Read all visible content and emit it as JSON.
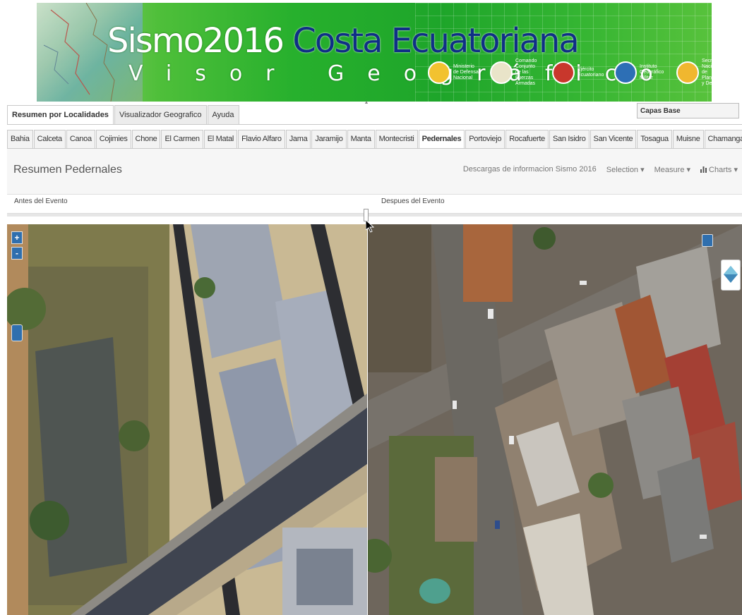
{
  "banner": {
    "title_part1": "Sismo2016",
    "title_part2": "Costa Ecuatoriana",
    "subtitle": "Visor Geográfico",
    "logos": [
      {
        "name": "Ministerio de Defensa Nacional",
        "lines": [
          "Ministerio",
          "de Defensa",
          "Nacional"
        ],
        "color": "#f2c230"
      },
      {
        "name": "Comando Conjunto de las Fuerzas Armadas",
        "lines": [
          "Comando Conjunto",
          "de las Fuerzas",
          "Armadas"
        ],
        "color": "#e9e4c9"
      },
      {
        "name": "Ejército Ecuatoriano",
        "lines": [
          "Ejército",
          "Ecuatoriano"
        ],
        "color": "#c8372c"
      },
      {
        "name": "Instituto Geográfico Militar",
        "lines": [
          "Instituto",
          "Geográfico",
          "Militar"
        ],
        "color": "#2d6fb5"
      },
      {
        "name": "Secretaría Nacional de Planificación y Desarrollo",
        "lines": [
          "Secretaría Nacional",
          "de Planificación",
          "y Desarrollo"
        ],
        "color": "#f0b72f"
      }
    ]
  },
  "main_tabs": [
    {
      "label": "Resumen por Localidades",
      "active": true
    },
    {
      "label": "Visualizador Geografico",
      "active": false
    },
    {
      "label": "Ayuda",
      "active": false
    }
  ],
  "capas_base": {
    "label": "Capas Base"
  },
  "location_tabs": [
    {
      "label": "Bahia",
      "active": false
    },
    {
      "label": "Calceta",
      "active": false
    },
    {
      "label": "Canoa",
      "active": false
    },
    {
      "label": "Cojimies",
      "active": false
    },
    {
      "label": "Chone",
      "active": false
    },
    {
      "label": "El Carmen",
      "active": false
    },
    {
      "label": "El Matal",
      "active": false
    },
    {
      "label": "Flavio Alfaro",
      "active": false
    },
    {
      "label": "Jama",
      "active": false
    },
    {
      "label": "Jaramijo",
      "active": false
    },
    {
      "label": "Manta",
      "active": false
    },
    {
      "label": "Montecristi",
      "active": false
    },
    {
      "label": "Pedernales",
      "active": true
    },
    {
      "label": "Portoviejo",
      "active": false
    },
    {
      "label": "Rocafuerte",
      "active": false
    },
    {
      "label": "San Isidro",
      "active": false
    },
    {
      "label": "San Vicente",
      "active": false
    },
    {
      "label": "Tosagua",
      "active": false
    },
    {
      "label": "Muisne",
      "active": false
    },
    {
      "label": "Chamanga",
      "active": false
    }
  ],
  "panel": {
    "title": "Resumen Pedernales",
    "links": {
      "downloads": "Descargas de informacion Sismo 2016",
      "selection": "Selection ▾",
      "measure": "Measure ▾",
      "charts": "Charts ▾"
    }
  },
  "compare": {
    "before_label": "Antes del Evento",
    "after_label": "Despues del Evento"
  },
  "map_controls": {
    "zoom_in": "+",
    "zoom_out": "-"
  },
  "colors": {
    "accent": "#2f6fae",
    "banner_green": "#1ea52a",
    "title_blue": "#0f2f86"
  }
}
